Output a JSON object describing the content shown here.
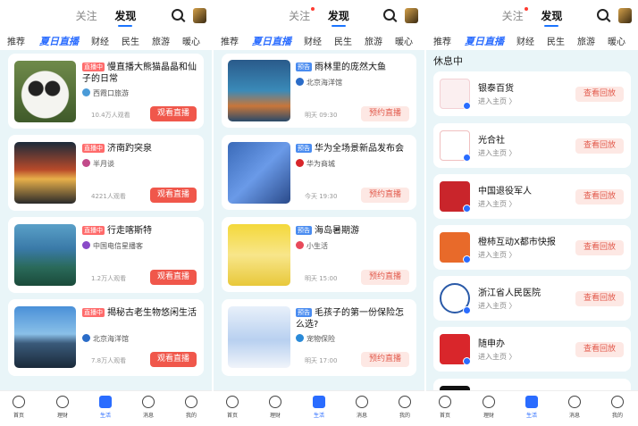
{
  "top": {
    "follow": "关注",
    "discover": "发现"
  },
  "categories": [
    "推荐",
    "夏日直播",
    "财经",
    "民生",
    "旅游",
    "暖心"
  ],
  "panel1": {
    "cards": [
      {
        "tag": "直播中",
        "title": "慢直播大熊猫晶晶和仙子的日常",
        "source": "西霞口旅游",
        "viewers": "10.4万人观看",
        "button": "观看直播"
      },
      {
        "tag": "直播中",
        "title": "济南趵突泉",
        "source": "半月谈",
        "viewers": "4221人观看",
        "button": "观看直播"
      },
      {
        "tag": "直播中",
        "title": "行走喀斯特",
        "source": "中国电信星播客",
        "viewers": "1.2万人观看",
        "button": "观看直播"
      },
      {
        "tag": "直播中",
        "title": "揭秘古老生物悠闲生活",
        "source": "北京海洋馆",
        "viewers": "7.8万人观看",
        "button": "观看直播"
      }
    ]
  },
  "panel2": {
    "cards": [
      {
        "tag": "预告",
        "title": "雨林里的庞然大鱼",
        "source": "北京海洋馆",
        "time": "明天 09:30",
        "button": "预约直播"
      },
      {
        "tag": "预告",
        "title": "华为全场景新品发布会",
        "source": "华为商城",
        "time": "今天 19:30",
        "button": "预约直播"
      },
      {
        "tag": "预告",
        "title": "海岛暑期游",
        "source": "小生活",
        "time": "明天 15:00",
        "button": "预约直播"
      },
      {
        "tag": "预告",
        "title": "毛孩子的第一份保险怎么选?",
        "source": "宠物保险",
        "time": "明天 17:00",
        "button": "预约直播"
      }
    ]
  },
  "panel3": {
    "header": "休息中",
    "items": [
      {
        "name": "银泰百货",
        "sub": "进入主页 〉",
        "button": "查看回放",
        "color": "#c8283c"
      },
      {
        "name": "光合社",
        "sub": "进入主页 〉",
        "button": "查看回放",
        "color": "#d9262b"
      },
      {
        "name": "中国退役军人",
        "sub": "进入主页 〉",
        "button": "查看回放",
        "color": "#c9252b"
      },
      {
        "name": "橙柿互动X都市快报",
        "sub": "进入主页 〉",
        "button": "查看回放",
        "color": "#e86a2a"
      },
      {
        "name": "浙江省人民医院",
        "sub": "进入主页 〉",
        "button": "查看回放",
        "color": "#2a5aa8"
      },
      {
        "name": "随申办",
        "sub": "进入主页 〉",
        "button": "查看回放",
        "color": "#d9262b"
      }
    ]
  },
  "bottom_nav": [
    "首页",
    "理财",
    "生活",
    "消息",
    "我的"
  ]
}
